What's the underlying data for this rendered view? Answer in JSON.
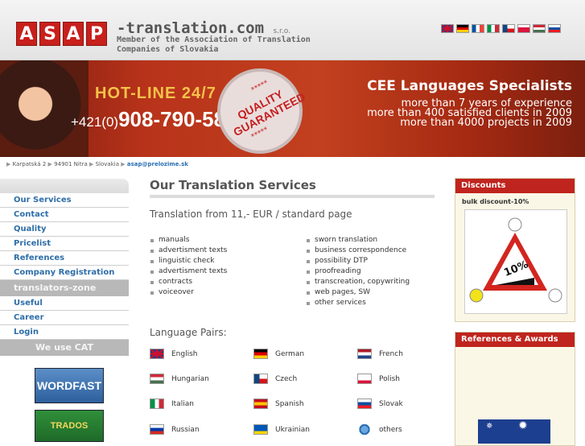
{
  "header": {
    "logo_letters": [
      "A",
      "S",
      "A",
      "P"
    ],
    "site_name": "-translation.com",
    "site_suffix": "s.r.o.",
    "member_text": "Member of the Association of Translation Companies of Slovakia",
    "flags": [
      {
        "name": "uk-flag",
        "colors": [
          "#1f3b8c",
          "#ffffff",
          "#c8102e"
        ]
      },
      {
        "name": "german-flag",
        "colors": [
          "#000000",
          "#dd0000",
          "#ffce00"
        ]
      },
      {
        "name": "french-flag",
        "colors": [
          "#0055a4",
          "#ffffff",
          "#ef4135"
        ]
      },
      {
        "name": "italian-flag",
        "colors": [
          "#009246",
          "#ffffff",
          "#ce2b37"
        ]
      },
      {
        "name": "czech-flag",
        "colors": [
          "#ffffff",
          "#d7141a",
          "#11457e"
        ]
      },
      {
        "name": "polish-flag",
        "colors": [
          "#ffffff",
          "#dc143c",
          "#dc143c"
        ]
      },
      {
        "name": "hungarian-flag",
        "colors": [
          "#ce2939",
          "#ffffff",
          "#477050"
        ]
      },
      {
        "name": "slovak-flag",
        "colors": [
          "#ffffff",
          "#0b4ea2",
          "#ee1c25"
        ]
      }
    ]
  },
  "banner": {
    "hotline": "HOT-LINE 24/7",
    "phone_prefix": "+421(0)",
    "phone": "908-790-586",
    "seal_stars_top": "*****",
    "seal_text": "QUALITY GUARANTEED",
    "seal_stars_bottom": "*****",
    "cee_title": "CEE Languages Specialists",
    "stats": [
      "more than 7 years of experience",
      "more than 400 satisfied clients in 2009",
      "more than 4000 projects in 2009"
    ]
  },
  "breadcrumb": {
    "items": [
      "Karpatská 2",
      "94901 Nitra",
      "Slovakia"
    ],
    "email": "asap@prelozime.sk"
  },
  "sidebar": {
    "items": [
      "Our Services",
      "Contact",
      "Quality",
      "Pricelist",
      "References",
      "Company Registration"
    ],
    "zone_header": "translators-zone",
    "zone_items": [
      "Useful",
      "Career",
      "Login"
    ],
    "cat_header": "We use CAT",
    "cat_tools": [
      "WORDFAST",
      "TRADOS"
    ]
  },
  "main": {
    "title": "Our Translation Services",
    "from_text": "Translation from 11,- EUR / standard page",
    "services_left": [
      "manuals",
      "advertisment texts",
      "linguistic check",
      "advertisment texts",
      "contracts",
      "voiceover"
    ],
    "services_right": [
      "sworn translation",
      "business correspondence",
      "possibility DTP",
      "proofreading",
      "transcreation, copywriting",
      "web pages, SW",
      "other services"
    ],
    "language_pairs_title": "Language Pairs:",
    "languages": [
      {
        "label": "English",
        "flag": "uk-flag",
        "colors": [
          "#1f3b8c",
          "#ffffff",
          "#c8102e"
        ]
      },
      {
        "label": "German",
        "flag": "german-flag",
        "colors": [
          "#000000",
          "#dd0000",
          "#ffce00"
        ]
      },
      {
        "label": "French",
        "flag": "dutch-flag",
        "colors": [
          "#ae1c28",
          "#ffffff",
          "#21468b"
        ]
      },
      {
        "label": "Hungarian",
        "flag": "hungarian-flag",
        "colors": [
          "#ce2939",
          "#ffffff",
          "#477050"
        ]
      },
      {
        "label": "Czech",
        "flag": "czech-flag",
        "colors": [
          "#ffffff",
          "#d7141a",
          "#11457e"
        ]
      },
      {
        "label": "Polish",
        "flag": "polish-flag",
        "colors": [
          "#ffffff",
          "#ffffff",
          "#dc143c"
        ]
      },
      {
        "label": "Italian",
        "flag": "italian-flag",
        "colors": [
          "#009246",
          "#ffffff",
          "#ce2b37"
        ]
      },
      {
        "label": "Spanish",
        "flag": "spanish-flag",
        "colors": [
          "#c60b1e",
          "#ffc400",
          "#c60b1e"
        ]
      },
      {
        "label": "Slovak",
        "flag": "slovak-flag",
        "colors": [
          "#ffffff",
          "#0b4ea2",
          "#ee1c25"
        ]
      },
      {
        "label": "Russian",
        "flag": "russian-flag",
        "colors": [
          "#ffffff",
          "#0039a6",
          "#d52b1e"
        ]
      },
      {
        "label": "Ukrainian",
        "flag": "ukrainian-flag",
        "colors": [
          "#0057b7",
          "#0057b7",
          "#ffd700"
        ]
      },
      {
        "label": "others",
        "flag": "globe-icon",
        "colors": [
          "#2a6fb3",
          "#6aa7e0",
          "#2a6fb3"
        ]
      }
    ]
  },
  "discounts": {
    "title": "Discounts",
    "subtitle": "bulk discount-10%",
    "sign_text": "10%"
  },
  "references": {
    "title": "References & Awards"
  },
  "colors": {
    "accent": "#c0241e",
    "link": "#2e6ea8"
  }
}
